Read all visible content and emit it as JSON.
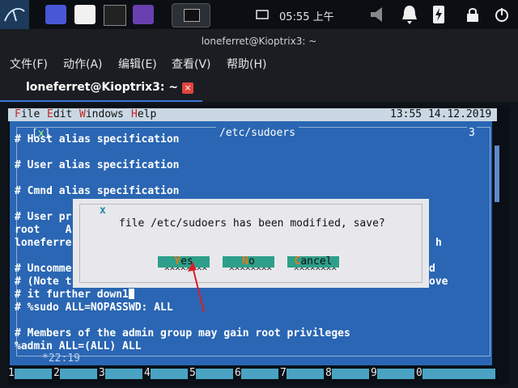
{
  "panel": {
    "clock": "05:55 上午"
  },
  "window": {
    "title": "loneferret@Kioptrix3: ~"
  },
  "menubar": [
    "文件(F)",
    "动作(A)",
    "编辑(E)",
    "查看(V)",
    "帮助(H)"
  ],
  "tab": {
    "label": "loneferret@Kioptrix3: ~",
    "close": "×"
  },
  "mc_menu": {
    "items": [
      "File",
      "Edit",
      "Windows",
      "Help"
    ],
    "datetime": "13:55 14.12.2019"
  },
  "editor": {
    "close_mark": "x",
    "filename": "/etc/sudoers",
    "window_number": "3",
    "lines": [
      "# Host alias specification",
      "",
      "# User alias specification",
      "",
      "# Cmnd alias specification",
      "",
      "# User pr",
      "root    A",
      "loneferre",
      "",
      "# Uncomme",
      "# (Note t",
      "# it further down1",
      "# %sudo ALL=NOPASSWD: ALL",
      "",
      "# Members of the admin group may gain root privileges",
      "%admin ALL=(ALL) ALL"
    ],
    "right_fragments": {
      "h": "h",
      "d": "d",
      "ove": "ove"
    },
    "position": "*22:19"
  },
  "dialog": {
    "close_mark": "x",
    "message": "file /etc/sudoers has been modified, save?",
    "buttons": [
      {
        "hotkey": "Y",
        "rest": "es",
        "selected": true
      },
      {
        "hotkey": "N",
        "rest": "o",
        "selected": false
      },
      {
        "hotkey": "C",
        "rest": "ancel",
        "selected": false
      }
    ],
    "carets": "^^^^^^^^"
  },
  "fkeys": [
    "1",
    "2",
    "3",
    "4",
    "5",
    "6",
    "7",
    "8",
    "9",
    "0"
  ],
  "colors": {
    "editor_bg": "#2a66b3",
    "dialog_bg": "#e8e8ec",
    "button": "#2e9f8a",
    "hotkey": "#e07a1c",
    "annotation_arrow": "#d81e2a"
  }
}
